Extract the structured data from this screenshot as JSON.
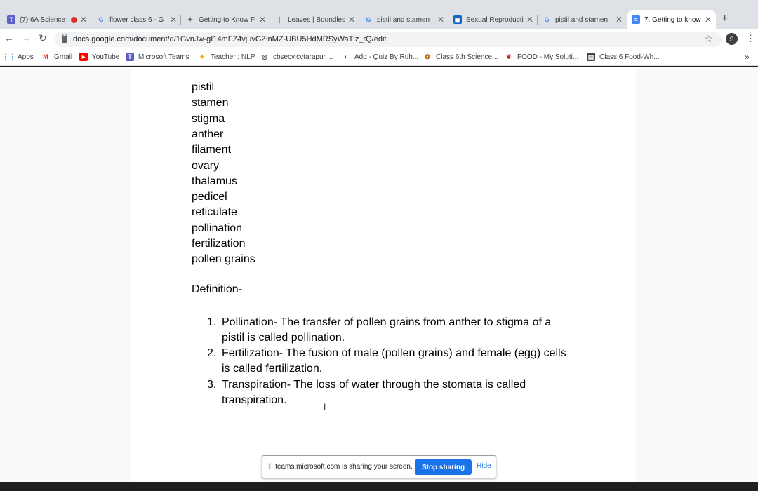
{
  "tabs": [
    {
      "title": "(7) 6A Science",
      "favicon": "teams-icon",
      "recording": true
    },
    {
      "title": "flower class 6 - G",
      "favicon": "google-icon"
    },
    {
      "title": "Getting to Know F",
      "favicon": "page-icon"
    },
    {
      "title": "Leaves | Boundless",
      "favicon": "boundless-icon"
    },
    {
      "title": "pistil and stamen",
      "favicon": "google-icon"
    },
    {
      "title": "Sexual Reproduction",
      "favicon": "site-icon"
    },
    {
      "title": "pistil and stamen",
      "favicon": "google-icon"
    },
    {
      "title": "7. Getting to know",
      "favicon": "docs-icon",
      "active": true
    }
  ],
  "address": {
    "url": "docs.google.com/document/d/1GvnJw-gI14mFZ4vjuvGZinMZ-UBU5HdMRSyWaTlz_rQ/edit"
  },
  "profile": {
    "initial": "S"
  },
  "bookmarks": [
    {
      "label": "Apps",
      "icon": "apps-grid-icon"
    },
    {
      "label": "Gmail",
      "icon": "gmail-icon"
    },
    {
      "label": "YouTube",
      "icon": "youtube-icon"
    },
    {
      "label": "Microsoft Teams",
      "icon": "teams-icon"
    },
    {
      "label": "Teacher : NLP",
      "icon": "teacher-icon"
    },
    {
      "label": "cbsecv.cvtarapur....",
      "icon": "site-icon"
    },
    {
      "label": "Add - Quiz By Ruh...",
      "icon": "quiz-icon"
    },
    {
      "label": "Class 6th Science...",
      "icon": "science-icon"
    },
    {
      "label": "FOOD - My Soluti...",
      "icon": "food-icon"
    },
    {
      "label": "Class 6 Food-Wh...",
      "icon": "class-icon"
    }
  ],
  "doc": {
    "words": [
      "pistil",
      "stamen",
      "stigma",
      "anther",
      "filament",
      "ovary",
      "thalamus",
      "pedicel",
      "reticulate",
      "pollination",
      "fertilization",
      "pollen grains"
    ],
    "heading": "Definition-",
    "definitions": [
      {
        "num": "1.",
        "text": "Pollination- The transfer of pollen grains from anther to stigma of a pistil is called pollination."
      },
      {
        "num": "2.",
        "text": "Fertilization- The fusion of male (pollen grains) and female (egg) cells is called fertilization."
      },
      {
        "num": "3.",
        "text": "Transpiration- The loss of water through the stomata is called transpiration."
      }
    ]
  },
  "sharing": {
    "message": "teams.microsoft.com is sharing your screen.",
    "stop_label": "Stop sharing",
    "hide_label": "Hide"
  },
  "colors": {
    "accent": "#1a73e8",
    "tabstrip": "#dee1e6",
    "recording": "#d93025"
  }
}
